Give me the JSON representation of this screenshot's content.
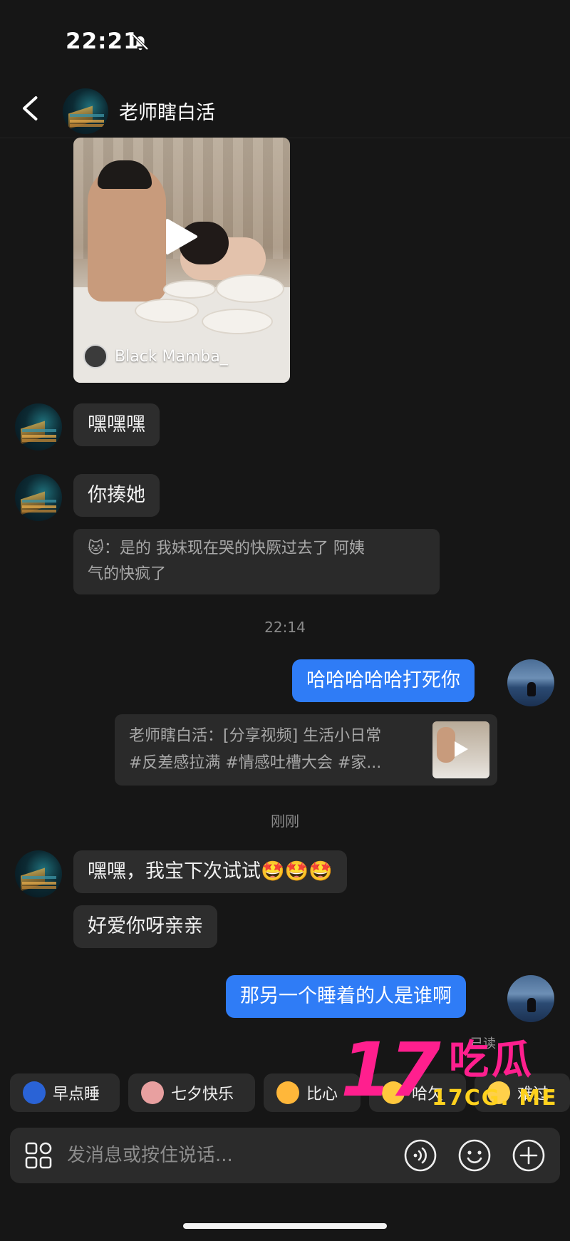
{
  "status_bar": {
    "time": "22:21"
  },
  "header": {
    "title": "老师瞎白活"
  },
  "video_card": {
    "author": "Black Mamba_"
  },
  "messages": {
    "m1": "嘿嘿嘿",
    "m2": "你揍她",
    "m2_quote_line1": "🐱：是的   我妹现在哭的快厥过去了  阿姨",
    "m2_quote_line2": "气的快疯了",
    "time1": "22:14",
    "m3": "哈哈哈哈哈打死你",
    "share_line1": "老师瞎白活：[分享视频] 生活小日常",
    "share_line2": "#反差感拉满 #情感吐槽大会 #家...",
    "time2": "刚刚",
    "m4": "嘿嘿，我宝下次试试🤩🤩🤩",
    "m5": "好爱你呀亲亲",
    "m6": "那另一个睡着的人是谁啊",
    "read_status": "已读"
  },
  "quick_replies": [
    {
      "label": "早点睡",
      "icon": "moon-emoji-icon",
      "color": "#f5c242"
    },
    {
      "label": "七夕快乐",
      "icon": "bird-emoji-icon",
      "color": "#e8a0a0"
    },
    {
      "label": "比心",
      "icon": "heart-hands-emoji-icon",
      "color": "#ffb73a"
    },
    {
      "label": "哈欠",
      "icon": "yawn-emoji-icon",
      "color": "#ffc83d"
    },
    {
      "label": "难过",
      "icon": "sad-emoji-icon",
      "color": "#ffd04a"
    }
  ],
  "input": {
    "placeholder": "发消息或按住说话..."
  },
  "watermark": {
    "big": "17",
    "cn": "吃瓜",
    "site": "17CG. ME"
  },
  "colors": {
    "background": "#161616",
    "bubble_in": "#2d2d2d",
    "bubble_out": "#2f7cf6",
    "watermark": "#ff1f8e"
  }
}
